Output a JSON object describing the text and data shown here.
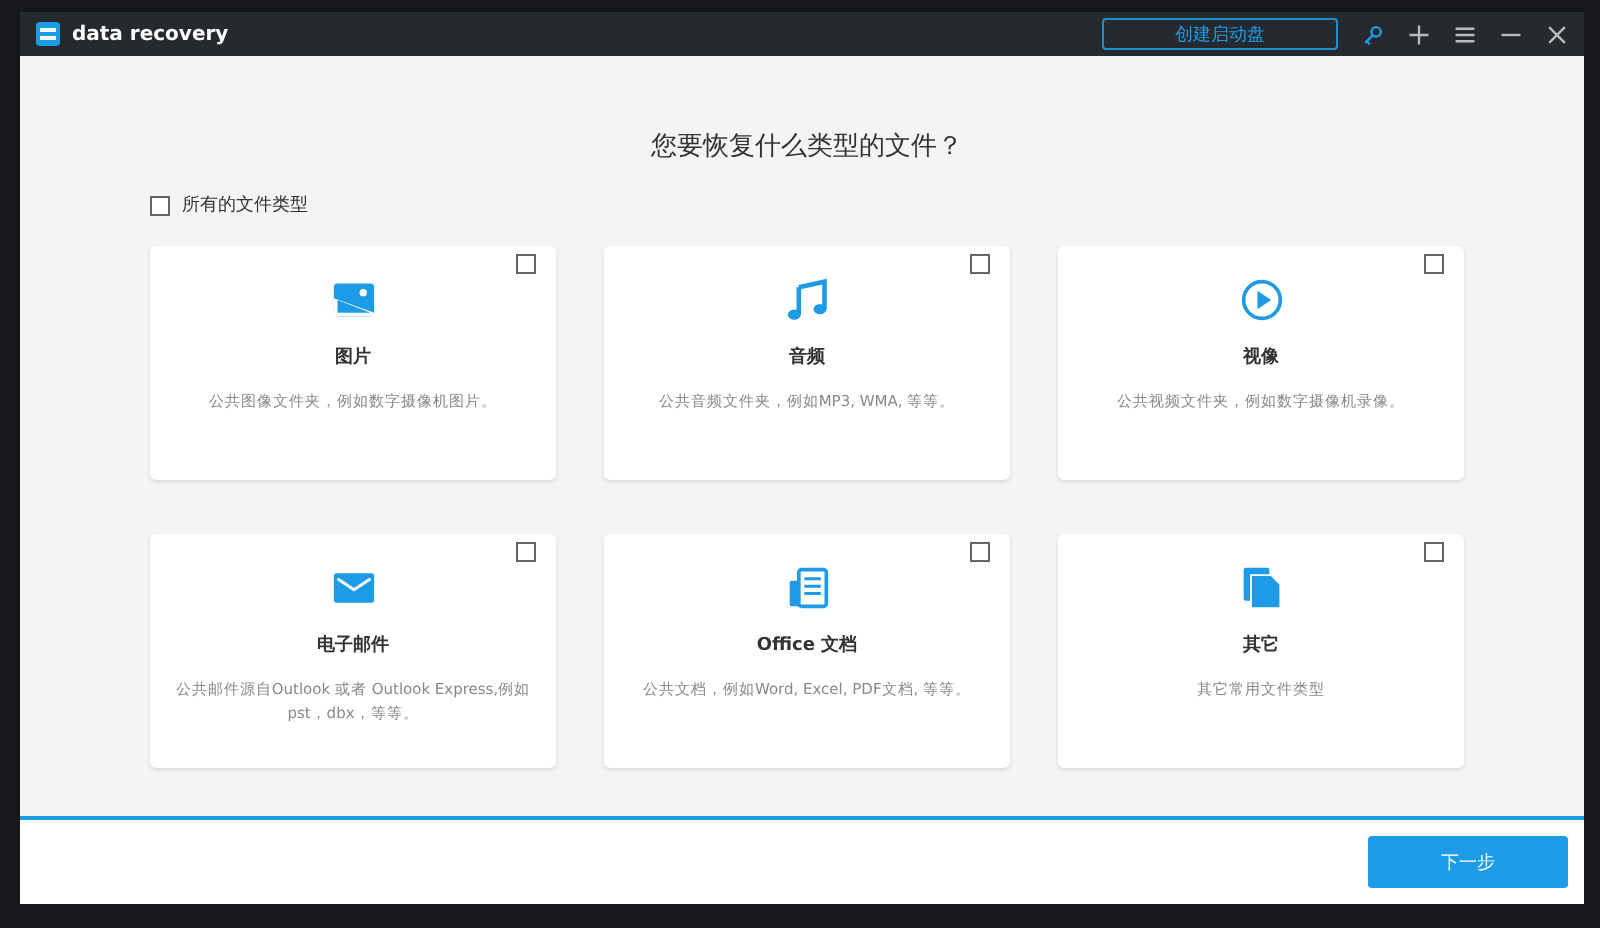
{
  "window": {
    "title": "data recovery",
    "boot_button": "创建启动盘"
  },
  "heading": "您要恢复什么类型的文件？",
  "all_types": {
    "label": "所有的文件类型",
    "checked": false
  },
  "types": [
    {
      "kind": "image",
      "title": "图片",
      "description": "公共图像文件夹，例如数字摄像机图片。",
      "checked": false
    },
    {
      "kind": "audio",
      "title": "音频",
      "description": "公共音频文件夹，例如MP3, WMA, 等等。",
      "checked": false
    },
    {
      "kind": "video",
      "title": "视像",
      "description": "公共视频文件夹，例如数字摄像机录像。",
      "checked": false
    },
    {
      "kind": "email",
      "title": "电子邮件",
      "description": "公共邮件源自Outlook 或者 Outlook Express,例如pst，dbx，等等。",
      "checked": false
    },
    {
      "kind": "document",
      "title": "Office 文档",
      "description": "公共文档，例如Word, Excel, PDF文档, 等等。",
      "checked": false
    },
    {
      "kind": "other",
      "title": "其它",
      "description": "其它常用文件类型",
      "checked": false
    }
  ],
  "next_button": "下一步"
}
